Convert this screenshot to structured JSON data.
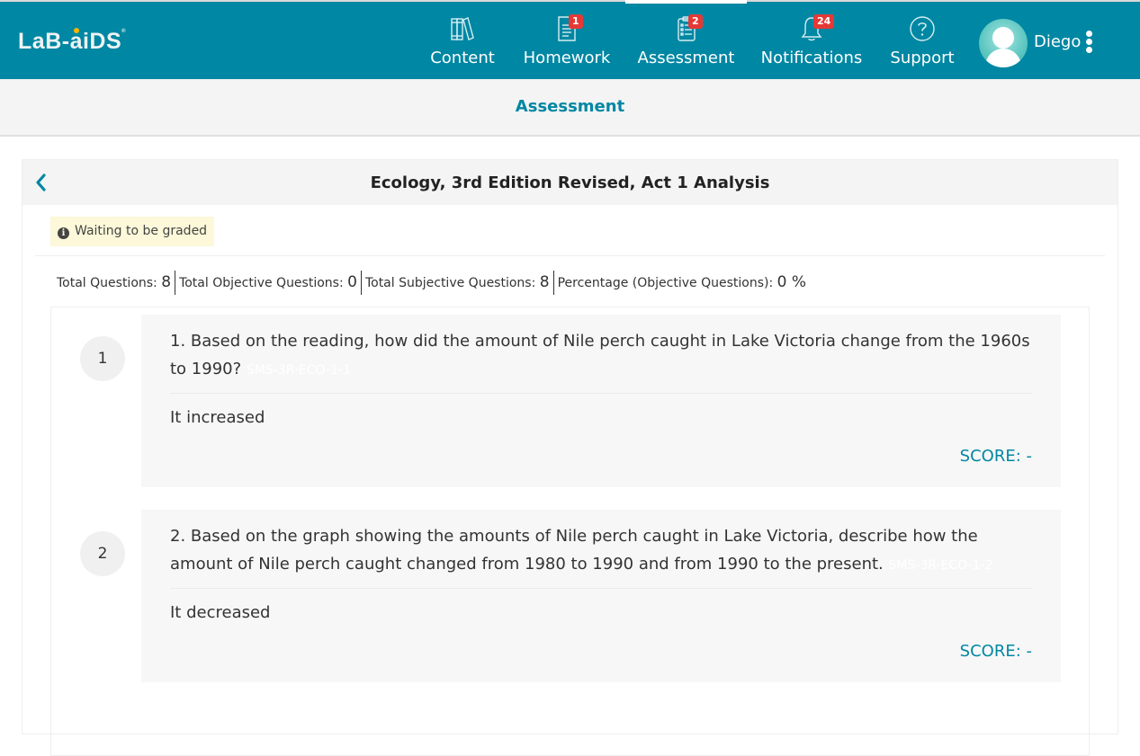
{
  "brand": {
    "logo_text": "LaB-aiDS",
    "accent_color": "#0087a3",
    "badge_color": "#e53935"
  },
  "nav": {
    "items": [
      {
        "label": "Content",
        "icon": "books-icon",
        "badge": null
      },
      {
        "label": "Homework",
        "icon": "document-icon",
        "badge": "1"
      },
      {
        "label": "Assessment",
        "icon": "clipboard-list-icon",
        "badge": "2",
        "active": true
      },
      {
        "label": "Notifications",
        "icon": "bell-icon",
        "badge": "24"
      },
      {
        "label": "Support",
        "icon": "question-circle-icon",
        "badge": null
      }
    ],
    "user": {
      "name": "Diego"
    }
  },
  "subheader": {
    "title": "Assessment"
  },
  "panel": {
    "title": "Ecology, 3rd Edition Revised, Act 1 Analysis",
    "status": "Waiting to be graded",
    "stats": [
      {
        "label": "Total Questions:",
        "value": "8"
      },
      {
        "label": "Total Objective Questions:",
        "value": "0"
      },
      {
        "label": "Total Subjective Questions:",
        "value": "8"
      },
      {
        "label": "Percentage (Objective Questions):",
        "value": "0 %"
      }
    ]
  },
  "questions": [
    {
      "number": "1",
      "text": "1. Based on the reading, how did the amount of Nile perch caught in Lake Victoria change from the 1960s to 1990?",
      "code": "SMS-3R-ECO-1-1",
      "answer": "It increased",
      "score": "SCORE: -"
    },
    {
      "number": "2",
      "text": "2. Based on the graph showing the amounts of Nile perch caught in Lake Victoria, describe how the amount of Nile perch caught changed from 1980 to 1990 and from 1990 to the present.",
      "code": "SMS-3R-ECO-1-2",
      "answer": "It decreased",
      "score": "SCORE: -"
    }
  ]
}
